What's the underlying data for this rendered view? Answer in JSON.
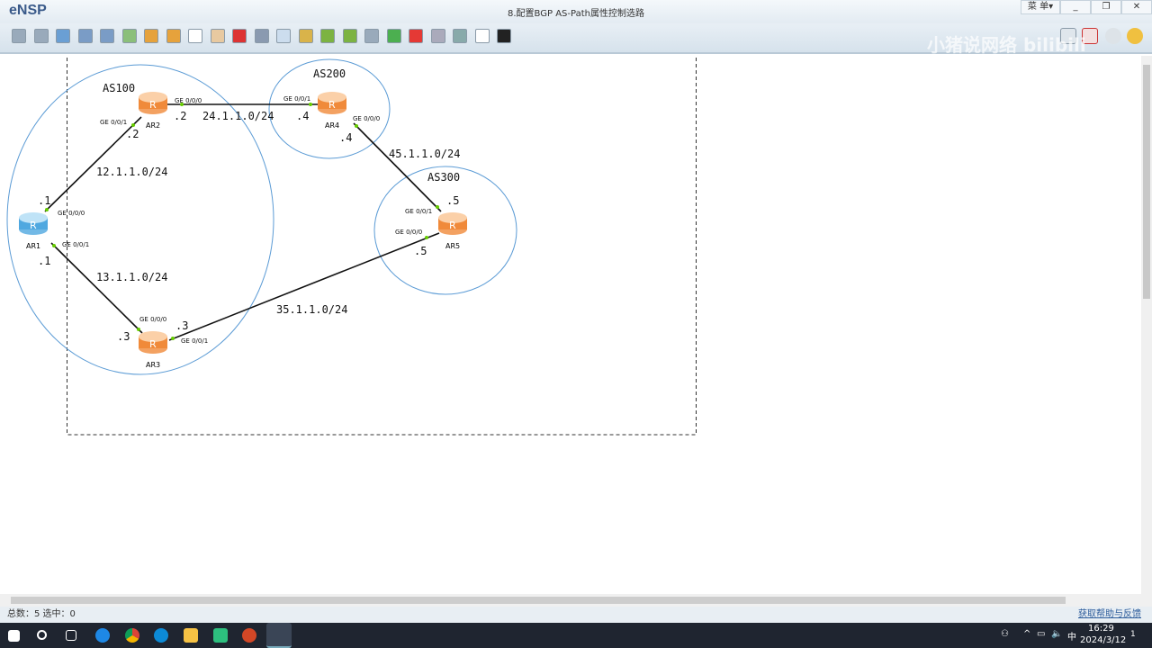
{
  "app": {
    "name": "eNSP",
    "title": "8.配置BGP  AS-Path属性控制选路",
    "menu": "菜 单▾",
    "minimize": "_",
    "restore": "❐",
    "close": "✕",
    "watermark": "小猪说网络  bilibili"
  },
  "toolbar": [
    "new-topology",
    "new-from-template",
    "open",
    "save",
    "save-as",
    "print",
    "undo",
    "redo",
    "select",
    "pan",
    "delete",
    "delete-links",
    "text-note",
    "palette",
    "zoom-in",
    "zoom-out",
    "fit",
    "start-device",
    "stop-device",
    "capture",
    "topology-tree",
    "interface-list",
    "console"
  ],
  "topology": {
    "areas": [
      {
        "label": "AS100"
      },
      {
        "label": "AS200"
      },
      {
        "label": "AS300"
      }
    ],
    "devices": [
      {
        "name": "AR1"
      },
      {
        "name": "AR2"
      },
      {
        "name": "AR3"
      },
      {
        "name": "AR4"
      },
      {
        "name": "AR5"
      }
    ],
    "interfaces": {
      "ar1_g0": "GE 0/0/0",
      "ar1_g1": "GE 0/0/1",
      "ar2_g1": "GE 0/0/1",
      "ar2_g0": "GE 0/0/0",
      "ar4_g1": "GE 0/0/1",
      "ar4_g0": "GE 0/0/0",
      "ar5_g1": "GE 0/0/1",
      "ar5_g0": "GE 0/0/0",
      "ar3_g0": "GE 0/0/0",
      "ar3_g1": "GE 0/0/1"
    },
    "hosts": {
      "ar1_a": ".1",
      "ar1_b": ".1",
      "ar2_a": ".2",
      "ar2_b": ".2",
      "ar4_a": ".4",
      "ar4_b": ".4",
      "ar5_a": ".5",
      "ar5_b": ".5",
      "ar3_a": ".3",
      "ar3_b": ".3"
    },
    "subnets": {
      "s12": "12.1.1.0/24",
      "s13": "13.1.1.0/24",
      "s24": "24.1.1.0/24",
      "s45": "45.1.1.0/24",
      "s35": "35.1.1.0/24"
    }
  },
  "status": {
    "text": "总数：5 选中：0",
    "help": "获取帮助与反馈"
  },
  "tray": {
    "ime": "中",
    "time": "16:29",
    "date": "2024/3/12",
    "notifications": "1"
  }
}
